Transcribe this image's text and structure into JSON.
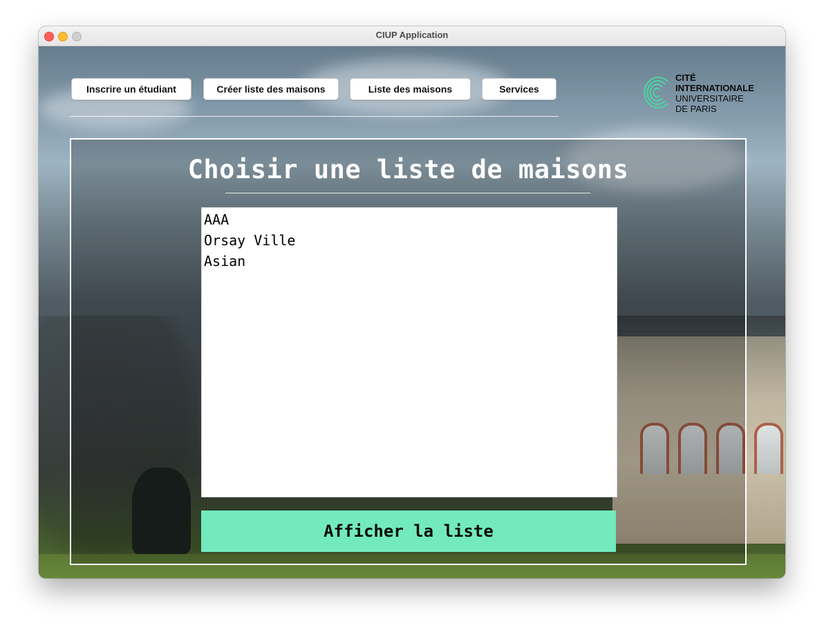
{
  "window": {
    "title": "CIUP Application"
  },
  "nav": {
    "items": [
      {
        "label": "Inscrire un étudiant"
      },
      {
        "label": "Créer liste des maisons"
      },
      {
        "label": "Liste des maisons"
      },
      {
        "label": "Services"
      }
    ]
  },
  "logo": {
    "lines": [
      "CITÉ",
      "INTERNATIONALE",
      "UNIVERSITAIRE",
      "DE PARIS"
    ],
    "color": "#49d6a2"
  },
  "main": {
    "title": "Choisir une liste de maisons",
    "list_items": [
      "AAA",
      "Orsay Ville",
      "Asian"
    ],
    "show_button_label": "Afficher la liste",
    "accent_color": "#72eabe"
  }
}
